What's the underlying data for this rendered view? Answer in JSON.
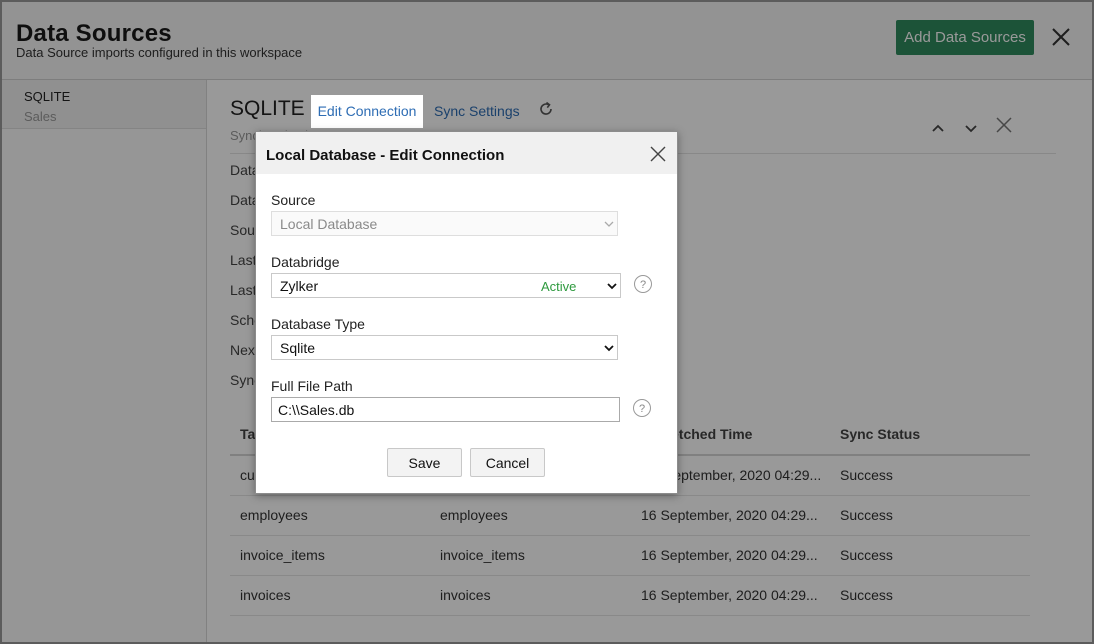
{
  "header": {
    "title": "Data Sources",
    "subtitle": "Data Source imports configured in this workspace",
    "add_button": "Add Data Sources"
  },
  "sidebar": {
    "items": [
      {
        "name": "SQLITE",
        "sub": "Sales"
      }
    ]
  },
  "source": {
    "title": "SQLITE",
    "tabs": {
      "edit": "Edit Connection",
      "sync": "Sync Settings"
    },
    "status_partial": "Synchronization Status",
    "info_labels": [
      "Data",
      "Data",
      "Sou",
      "Last",
      "Last",
      "Sche",
      "Next",
      "Sync"
    ]
  },
  "table": {
    "headers": [
      "Ta",
      "",
      "etched Time",
      "Sync Status"
    ],
    "rows": [
      {
        "c1": "cu",
        "c2": "",
        "c3": "September, 2020 04:29...",
        "c4": "Success"
      },
      {
        "c1": "employees",
        "c2": "employees",
        "c3": "16 September, 2020 04:29...",
        "c4": "Success"
      },
      {
        "c1": "invoice_items",
        "c2": "invoice_items",
        "c3": "16 September, 2020 04:29...",
        "c4": "Success"
      },
      {
        "c1": "invoices",
        "c2": "invoices",
        "c3": "16 September, 2020 04:29...",
        "c4": "Success"
      }
    ]
  },
  "dialog": {
    "title": "Local Database - Edit Connection",
    "source_label": "Source",
    "source_value": "Local Database",
    "databridge_label": "Databridge",
    "databridge_value": "Zylker",
    "databridge_status": "Active",
    "db_type_label": "Database Type",
    "db_type_value": "Sqlite",
    "path_label": "Full File Path",
    "path_value": "C:\\\\Sales.db",
    "save": "Save",
    "cancel": "Cancel",
    "help_glyph": "?"
  },
  "colors": {
    "accent": "#2f8a5e",
    "link": "#2e6db4",
    "active": "#2e9a3e"
  }
}
